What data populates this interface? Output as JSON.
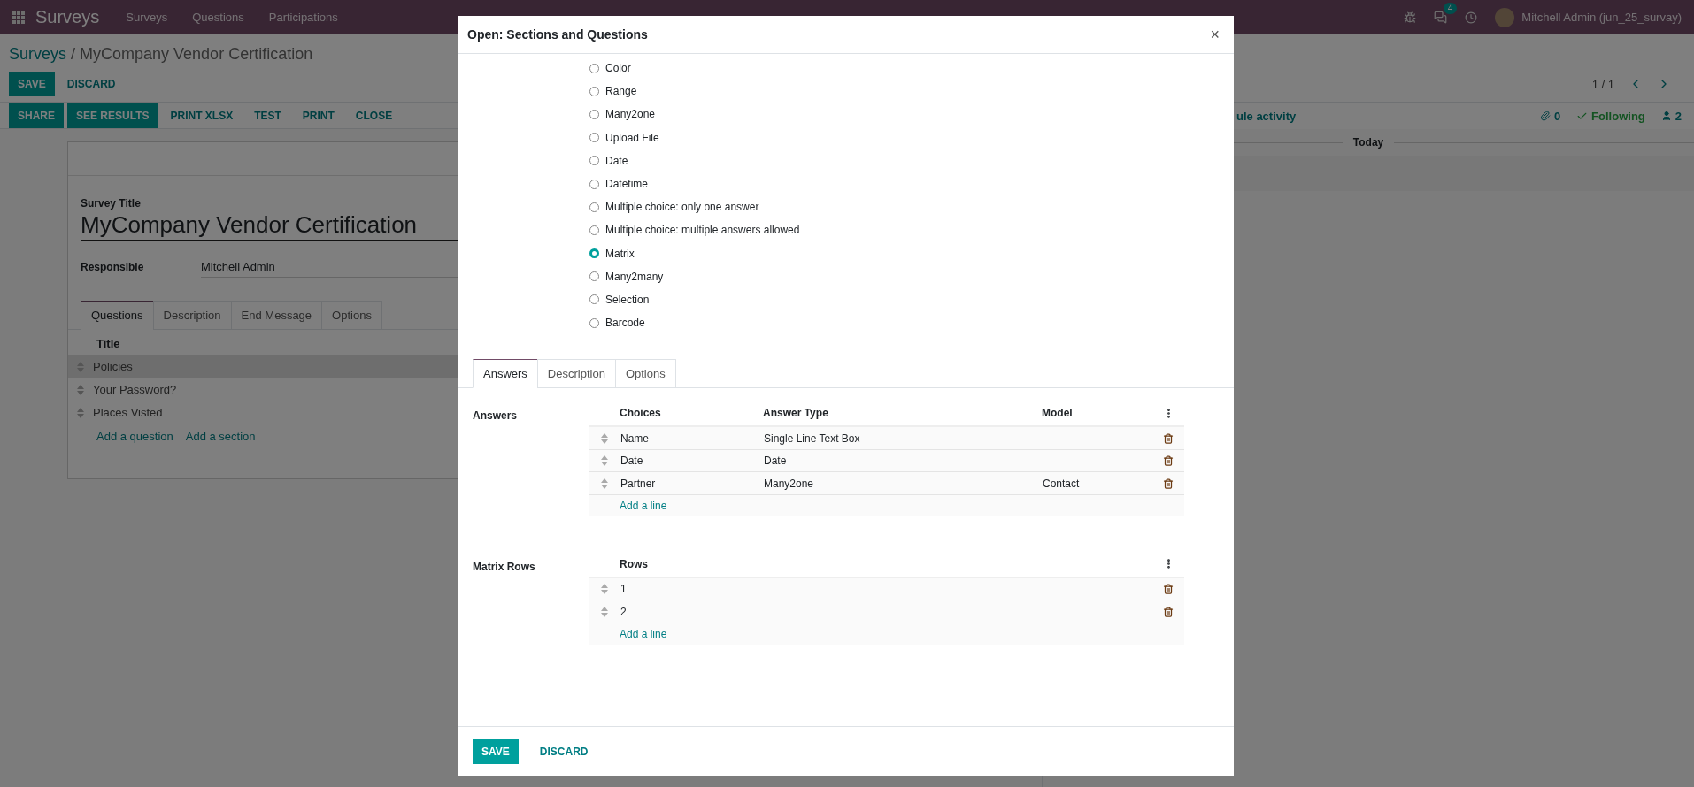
{
  "navbar": {
    "app_title": "Surveys",
    "menu": [
      "Surveys",
      "Questions",
      "Participations"
    ],
    "message_count": "4",
    "user": "Mitchell Admin (jun_25_survay)"
  },
  "breadcrumb": {
    "parent": "Surveys",
    "separator": "/",
    "current": "MyCompany Vendor Certification"
  },
  "edit_buttons": [
    {
      "label": "SAVE",
      "kind": "primary"
    },
    {
      "label": "DISCARD",
      "kind": "link"
    }
  ],
  "pager": "1 / 1",
  "header_buttons": [
    {
      "label": "SHARE",
      "kind": "primary"
    },
    {
      "label": "SEE RESULTS",
      "kind": "primary"
    },
    {
      "label": "PRINT XLSX",
      "kind": "link"
    },
    {
      "label": "TEST",
      "kind": "link"
    },
    {
      "label": "PRINT",
      "kind": "link"
    },
    {
      "label": "CLOSE",
      "kind": "link"
    }
  ],
  "chatter": {
    "activity_link": "ule activity",
    "attachments": "0",
    "follow": "Following",
    "followers": "2",
    "date_separator": "Today"
  },
  "form": {
    "title_label": "Survey Title",
    "title": "MyCompany Vendor Certification",
    "responsible_label": "Responsible",
    "responsible": "Mitchell Admin",
    "tabs": [
      {
        "label": "Questions",
        "selected": true
      },
      {
        "label": "Description",
        "selected": false
      },
      {
        "label": "End Message",
        "selected": false
      },
      {
        "label": "Options",
        "selected": false
      }
    ],
    "column": "Title",
    "rows": [
      {
        "title": "Policies",
        "kind": "section"
      },
      {
        "title": "Your Password?",
        "kind": "question"
      },
      {
        "title": "Places Visted",
        "kind": "question"
      }
    ],
    "add_links": [
      "Add a question",
      "Add a section"
    ]
  },
  "dialog": {
    "title": "Open: Sections and Questions",
    "close": "×",
    "question_types": [
      {
        "label": "Color",
        "selected": false
      },
      {
        "label": "Range",
        "selected": false
      },
      {
        "label": "Many2one",
        "selected": false
      },
      {
        "label": "Upload File",
        "selected": false
      },
      {
        "label": "Date",
        "selected": false
      },
      {
        "label": "Datetime",
        "selected": false
      },
      {
        "label": "Multiple choice: only one answer",
        "selected": false
      },
      {
        "label": "Multiple choice: multiple answers allowed",
        "selected": false
      },
      {
        "label": "Matrix",
        "selected": true
      },
      {
        "label": "Many2many",
        "selected": false
      },
      {
        "label": "Selection",
        "selected": false
      },
      {
        "label": "Barcode",
        "selected": false
      }
    ],
    "tabs": [
      {
        "label": "Answers",
        "selected": true
      },
      {
        "label": "Description",
        "selected": false
      },
      {
        "label": "Options",
        "selected": false
      }
    ],
    "sections": [
      {
        "label": "Answers",
        "columns": [
          "Choices",
          "Answer Type",
          "Model"
        ],
        "rows": [
          [
            "Name",
            "Single Line Text Box",
            ""
          ],
          [
            "Date",
            "Date",
            ""
          ],
          [
            "Partner",
            "Many2one",
            "Contact"
          ]
        ],
        "add_link": "Add a line"
      },
      {
        "label": "Matrix Rows",
        "columns": [
          "Rows"
        ],
        "rows": [
          [
            "1"
          ],
          [
            "2"
          ]
        ],
        "add_link": "Add a line"
      }
    ],
    "footer_buttons": [
      {
        "label": "SAVE",
        "kind": "primary"
      },
      {
        "label": "DISCARD",
        "kind": "link"
      }
    ]
  }
}
